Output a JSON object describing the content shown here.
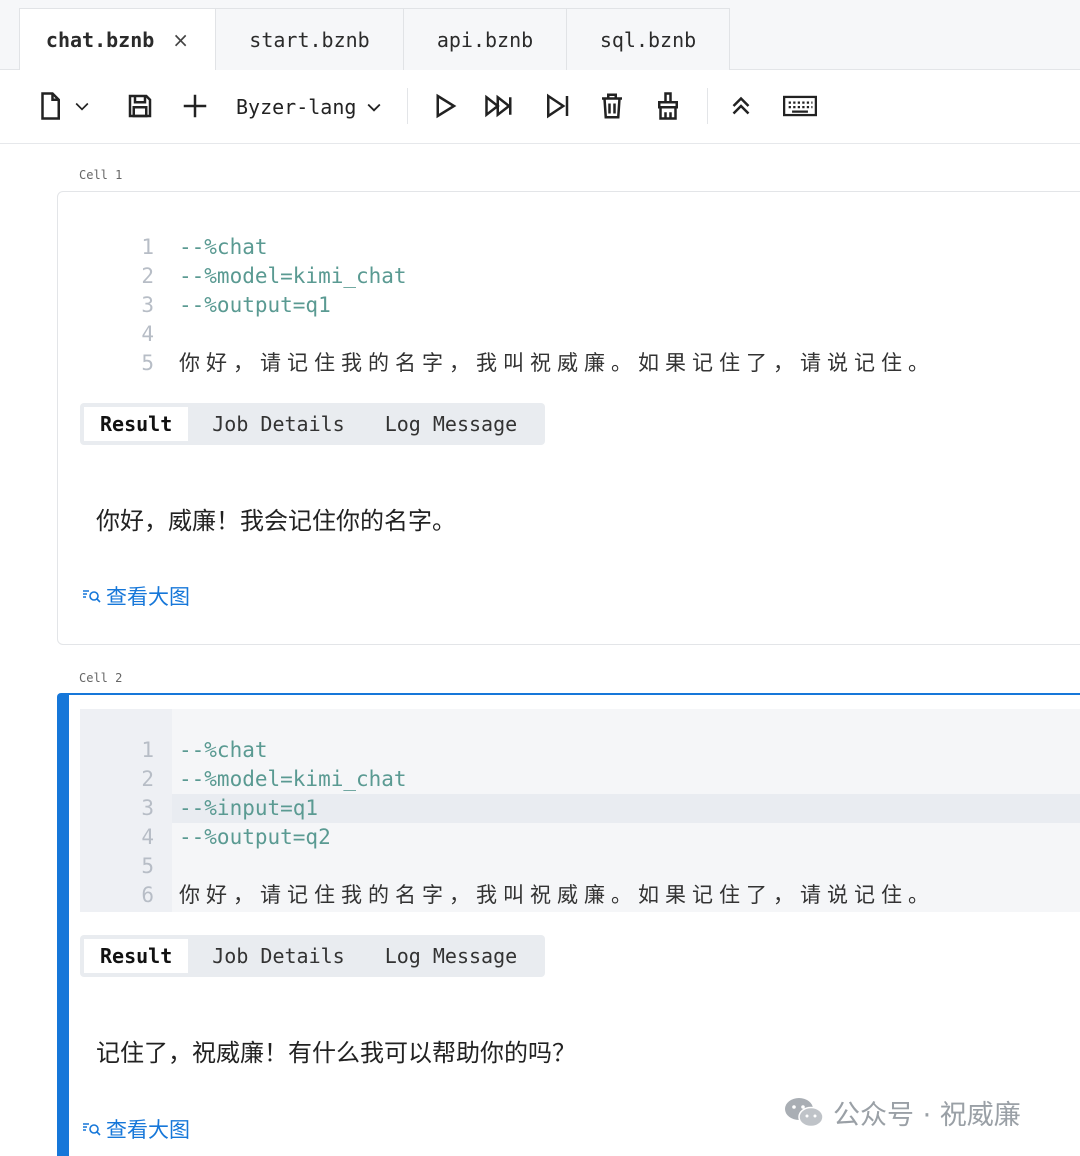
{
  "tabs": [
    {
      "label": "chat.bznb",
      "close": "×"
    },
    {
      "label": "start.bznb"
    },
    {
      "label": "api.bznb"
    },
    {
      "label": "sql.bznb"
    }
  ],
  "toolbar": {
    "language": "Byzer-lang",
    "icons": [
      "file-icon",
      "chevron-down-icon",
      "save-icon",
      "plus-icon",
      "play-icon",
      "run-all-icon",
      "run-to-end-icon",
      "trash-icon",
      "clear-output-icon",
      "collapse-icon",
      "keyboard-icon"
    ]
  },
  "cells": [
    {
      "label": "Cell 1",
      "lines": [
        {
          "n": "1",
          "text": "--%chat"
        },
        {
          "n": "2",
          "text": "--%model=kimi_chat"
        },
        {
          "n": "3",
          "text": "--%output=q1"
        },
        {
          "n": "4",
          "text": ""
        },
        {
          "n": "5",
          "text": "你好，请记住我的名字，我叫祝威廉。如果记住了，请说记住。"
        }
      ],
      "result_tabs": [
        "Result",
        "Job Details",
        "Log Message"
      ],
      "answer": "你好，威廉！我会记住你的名字。",
      "view_large": "查看大图"
    },
    {
      "label": "Cell 2",
      "lines": [
        {
          "n": "1",
          "text": "--%chat"
        },
        {
          "n": "2",
          "text": "--%model=kimi_chat"
        },
        {
          "n": "3",
          "text": "--%input=q1"
        },
        {
          "n": "4",
          "text": "--%output=q2"
        },
        {
          "n": "5",
          "text": ""
        },
        {
          "n": "6",
          "text": "你好，请记住我的名字，我叫祝威廉。如果记住了，请说记住。"
        }
      ],
      "result_tabs": [
        "Result",
        "Job Details",
        "Log Message"
      ],
      "answer": "记住了，祝威廉！有什么我可以帮助你的吗？",
      "view_large": "查看大图"
    }
  ],
  "watermark": "公众号 · 祝威廉",
  "colors": {
    "accent": "#1677d9",
    "code": "#5a9a92",
    "line_number": "#b7bdc6"
  }
}
